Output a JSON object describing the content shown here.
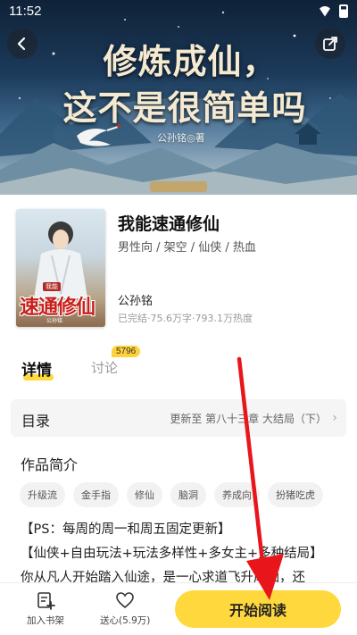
{
  "status_bar": {
    "time": "11:52"
  },
  "banner": {
    "title_line1": "修炼成仙，",
    "title_line2": "这不是很简单吗",
    "author_credit": "公孙铭◎著"
  },
  "book": {
    "title": "我能速通修仙",
    "tags": "男性向 / 架空 / 仙侠 / 热血",
    "author": "公孙铭",
    "stats": "已完结·75.6万字·793.1万热度",
    "cover": {
      "title_text": "速通修仙",
      "tag_text": "我能",
      "author_text": "公孙铭"
    }
  },
  "tabs": [
    {
      "label": "详情",
      "active": true
    },
    {
      "label": "讨论",
      "badge": "5796",
      "active": false
    }
  ],
  "toc": {
    "label": "目录",
    "latest": "更新至 第八十三章 大结局（下）"
  },
  "intro": {
    "heading": "作品简介",
    "chips": [
      "升级流",
      "金手指",
      "修仙",
      "脑洞",
      "养成向",
      "扮猪吃虎"
    ],
    "lines": [
      "【PS：每周的周一和周五固定更新】",
      "【仙侠+自由玩法+玩法多样性+多女主+多种结局】",
      "你从凡人开始踏入仙途，是一心求道飞升成仙，还"
    ]
  },
  "bottom_bar": {
    "shelf_label": "加入书架",
    "love_label": "送心(5.9万)",
    "read_label": "开始阅读"
  },
  "colors": {
    "accent_yellow": "#ffd83d",
    "annotation_red": "#e8161b"
  },
  "icons": [
    "back-icon",
    "share-icon",
    "add-to-shelf-icon",
    "heart-icon",
    "chevron-right-icon",
    "wifi-icon",
    "battery-icon"
  ]
}
